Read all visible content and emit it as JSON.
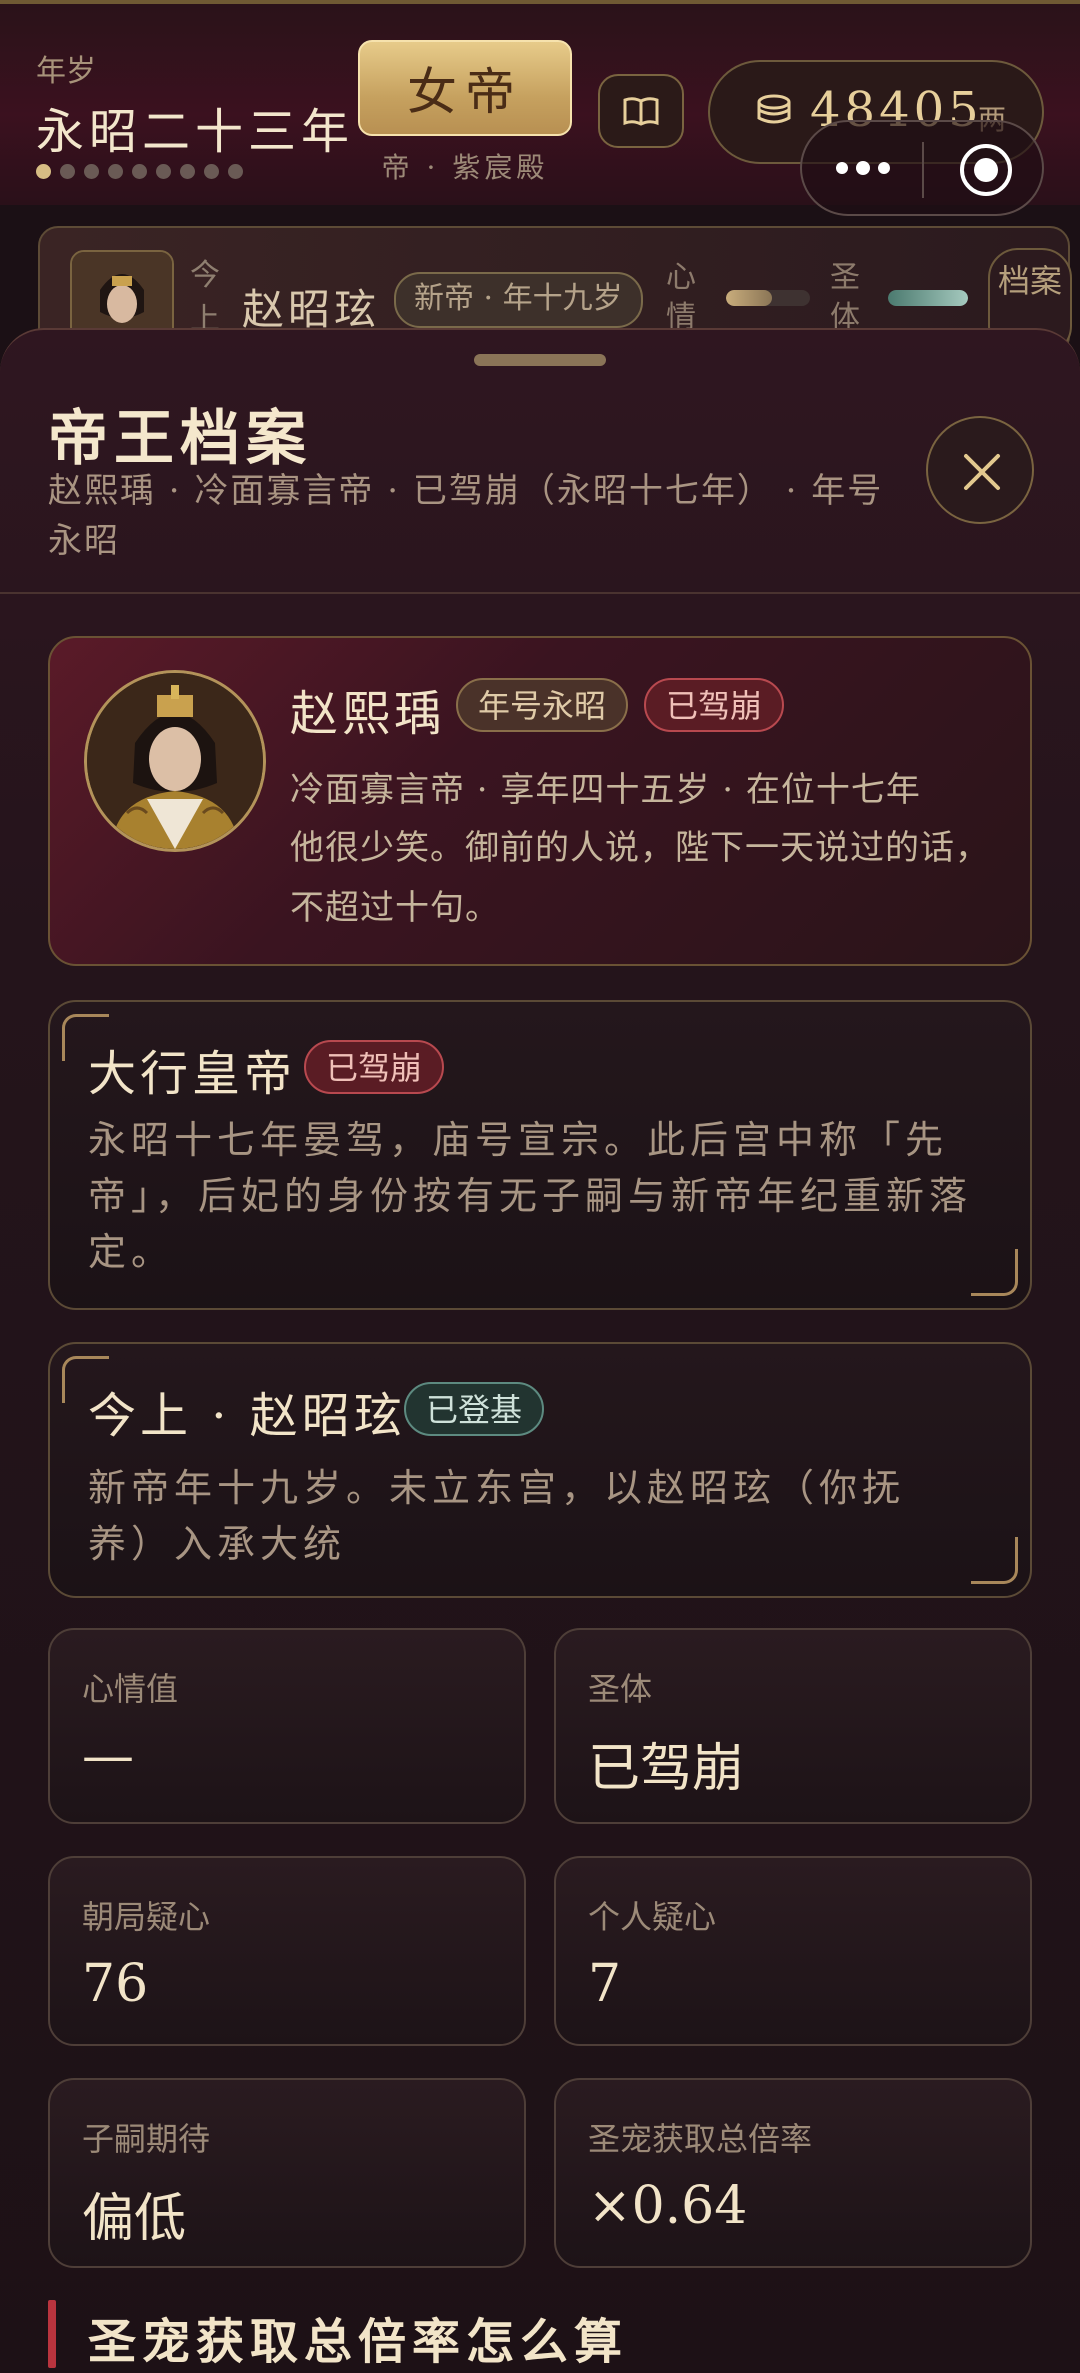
{
  "colors": {
    "accent_gold": "#d7bd84",
    "accent_red": "#b9343e",
    "background": "#1b1015",
    "sheet": "#24141b",
    "text_primary": "#f2e4c8",
    "text_secondary": "#a89583"
  },
  "header": {
    "era_label": "年岁",
    "era_value": "永昭二十三年",
    "progress_dots_total": 9,
    "progress_dots_active": 1,
    "title_button": "女帝",
    "palace_label": "帝 · 紫宸殿",
    "book_icon": "book-icon",
    "coins": {
      "icon": "coin-stack-icon",
      "value": "48405",
      "unit": "两"
    },
    "capsule": {
      "menu_icon": "more-dots-icon",
      "target_icon": "target-icon"
    }
  },
  "ruler_row": {
    "prefix": "今上",
    "name": "赵昭玹",
    "tag": "新帝 · 年十九岁",
    "mood_label": "心情",
    "mood_level": 0.55,
    "body_label": "圣体",
    "body_level": 1.0,
    "dossier_button": "档案"
  },
  "sheet": {
    "title": "帝王档案",
    "subtitle": "赵熙瑀 · 冷面寡言帝 · 已驾崩（永昭十七年） · 年号永昭",
    "close_icon": "close-icon"
  },
  "profile": {
    "name": "赵熙瑀",
    "tag_era": "年号永昭",
    "tag_status": "已驾崩",
    "line1": "冷面寡言帝 · 享年四十五岁 · 在位十七年",
    "description": "他很少笑。御前的人说，陛下一天说过的话，不超过十句。"
  },
  "late_emperor": {
    "title": "大行皇帝",
    "tag": "已驾崩",
    "text": "永昭十七年晏驾，庙号宣宗。此后宫中称「先帝」，后妃的身份按有无子嗣与新帝年纪重新落定。"
  },
  "current_emperor": {
    "title": "今上 · 赵昭玹",
    "tag": "已登基",
    "text": "新帝年十九岁。未立东宫，以赵昭玹（你抚养）入承大统"
  },
  "stats": [
    {
      "label": "心情值",
      "value": "—"
    },
    {
      "label": "圣体",
      "value": "已驾崩"
    },
    {
      "label": "朝局疑心",
      "value": "76"
    },
    {
      "label": "个人疑心",
      "value": "7"
    },
    {
      "label": "子嗣期待",
      "value": "偏低"
    },
    {
      "label": "圣宠获取总倍率",
      "value": "×0.64"
    }
  ],
  "section": {
    "title": "圣宠获取总倍率怎么算"
  }
}
